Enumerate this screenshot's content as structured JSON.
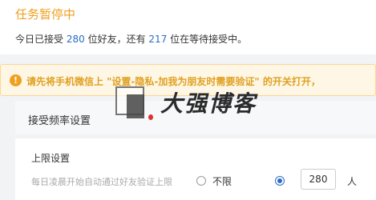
{
  "header": {
    "title": "任务暂停中"
  },
  "summary": {
    "prefix": "今日已接受",
    "accepted_count": "280",
    "middle": "位好友，还有",
    "waiting_count": "217",
    "suffix": "位在等待接受中。"
  },
  "warning": {
    "icon": "exclamation-icon",
    "text": "请先将手机微信上 \"设置-隐私-加我为朋友时需要验证\" 的开关打开，"
  },
  "frequency_section": {
    "title": "接受频率设置"
  },
  "limit_section": {
    "title": "上限设置",
    "description": "每日凌晨开始自动通过好友验证上限",
    "option_unlimited": "不限",
    "limit_value": "280",
    "unit": "人"
  },
  "watermark": {
    "text": "大强博客"
  },
  "colors": {
    "title": "#f0a020",
    "accent": "#2a6cc6",
    "warning_bg": "#fff7e6"
  }
}
